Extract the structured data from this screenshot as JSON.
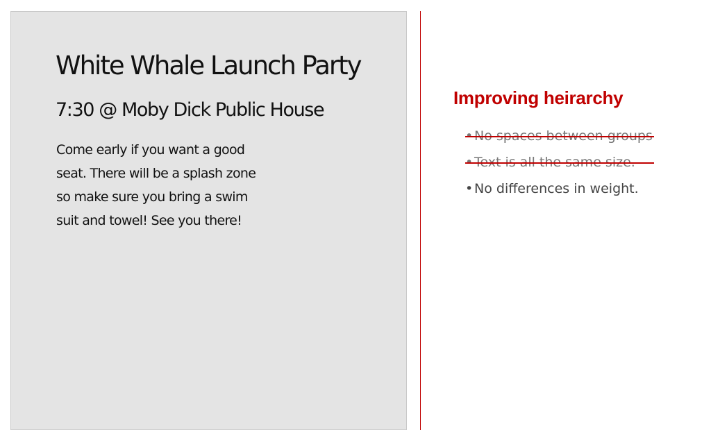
{
  "card": {
    "title": "White Whale Launch Party",
    "subtitle": "7:30 @ Moby Dick Public House",
    "body": "Come early if you want a good seat. There will be a splash zone so make sure you bring a swim suit and towel! See you there!"
  },
  "notes": {
    "title": "Improving heirarchy",
    "accent_color": "#c00000",
    "items": [
      {
        "text": "No spaces between groups",
        "struck": true
      },
      {
        "text": "Text is all the same size.",
        "struck": true
      },
      {
        "text": "No differences in weight.",
        "struck": false
      }
    ]
  }
}
